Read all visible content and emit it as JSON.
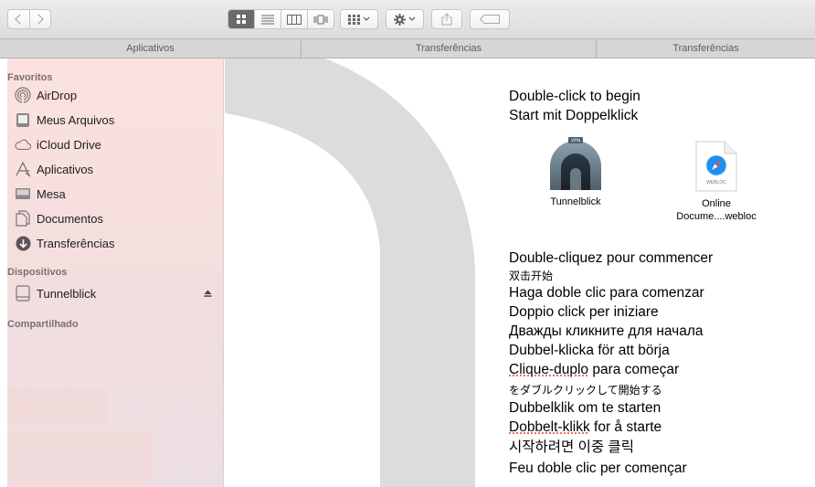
{
  "tabs": [
    "Aplicativos",
    "Transferências",
    "Transferências"
  ],
  "sidebar": {
    "favorites_header": "Favoritos",
    "favorites": [
      {
        "label": "AirDrop",
        "icon": "airdrop-icon"
      },
      {
        "label": "Meus Arquivos",
        "icon": "all-files-icon"
      },
      {
        "label": "iCloud Drive",
        "icon": "cloud-icon"
      },
      {
        "label": "Aplicativos",
        "icon": "applications-icon"
      },
      {
        "label": "Mesa",
        "icon": "desktop-icon"
      },
      {
        "label": "Documentos",
        "icon": "documents-icon"
      },
      {
        "label": "Transferências",
        "icon": "downloads-icon"
      }
    ],
    "devices_header": "Dispositivos",
    "devices": [
      {
        "label": "Tunnelblick",
        "icon": "disk-icon"
      }
    ],
    "shared_header": "Compartilhado"
  },
  "files": [
    {
      "name": "Tunnelblick",
      "icon": "tunnelblick-app-icon",
      "badge": "VPN"
    },
    {
      "name_line1": "Online",
      "name_line2": "Docume....webloc",
      "icon": "webloc-file-icon",
      "badge": "WEBLOC"
    }
  ],
  "readme": {
    "line1": "Double-click to begin",
    "line2": "Start mit Doppelklick",
    "lines": [
      "Double-cliquez pour commencer",
      "双击开始",
      "Haga doble clic para comenzar",
      "Doppio click per iniziare",
      "Дважды кликните для начала",
      "Dubbel-klicka för att börja",
      "Clique-duplo",
      " para começar",
      "をダブルクリックして開始する",
      "Dubbelklik om te starten",
      "Dobbelt-klikk",
      " for å starte",
      "시작하려면 이중 클릭",
      "Feu doble clic per començar"
    ]
  }
}
